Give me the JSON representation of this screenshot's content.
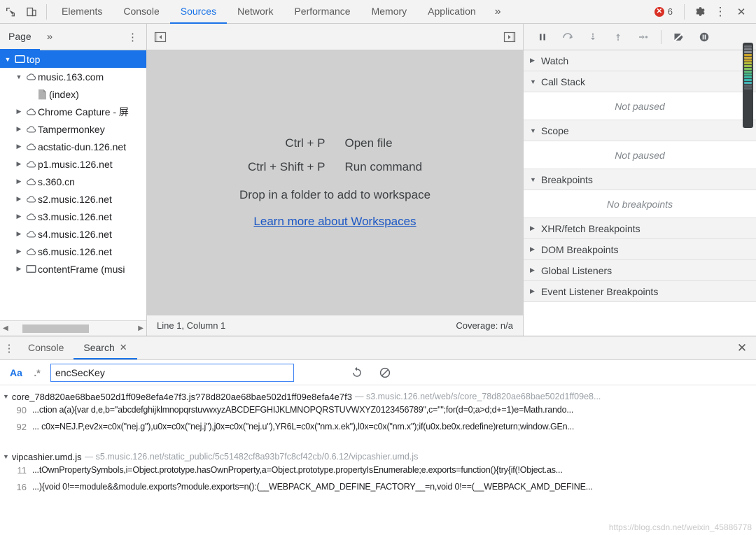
{
  "topbar": {
    "icons": [
      "inspect-icon",
      "device-toolbar-icon"
    ],
    "tabs": [
      {
        "label": "Elements",
        "active": false
      },
      {
        "label": "Console",
        "active": false
      },
      {
        "label": "Sources",
        "active": true
      },
      {
        "label": "Network",
        "active": false
      },
      {
        "label": "Performance",
        "active": false
      },
      {
        "label": "Memory",
        "active": false
      },
      {
        "label": "Application",
        "active": false
      }
    ],
    "more_label": "»",
    "error_count": "6",
    "settings_label": "⚙",
    "menu_label": "⋮",
    "close_label": "✕",
    "accent_color": "#1a73e8",
    "error_color": "#d93025"
  },
  "navigator": {
    "tab_label": "Page",
    "more_label": "»",
    "menu_label": "⋮",
    "tree": [
      {
        "label": "top",
        "icon": "frame-icon",
        "depth": 0,
        "arrow": "▼",
        "selected": true
      },
      {
        "label": "music.163.com",
        "icon": "cloud-icon",
        "depth": 1,
        "arrow": "▼",
        "selected": false
      },
      {
        "label": "(index)",
        "icon": "document-icon",
        "depth": 2,
        "arrow": "",
        "selected": false
      },
      {
        "label": "Chrome Capture - 屏",
        "icon": "cloud-icon",
        "depth": 1,
        "arrow": "▶",
        "selected": false
      },
      {
        "label": "Tampermonkey",
        "icon": "cloud-icon",
        "depth": 1,
        "arrow": "▶",
        "selected": false
      },
      {
        "label": "acstatic-dun.126.net",
        "icon": "cloud-icon",
        "depth": 1,
        "arrow": "▶",
        "selected": false
      },
      {
        "label": "p1.music.126.net",
        "icon": "cloud-icon",
        "depth": 1,
        "arrow": "▶",
        "selected": false
      },
      {
        "label": "s.360.cn",
        "icon": "cloud-icon",
        "depth": 1,
        "arrow": "▶",
        "selected": false
      },
      {
        "label": "s2.music.126.net",
        "icon": "cloud-icon",
        "depth": 1,
        "arrow": "▶",
        "selected": false
      },
      {
        "label": "s3.music.126.net",
        "icon": "cloud-icon",
        "depth": 1,
        "arrow": "▶",
        "selected": false
      },
      {
        "label": "s4.music.126.net",
        "icon": "cloud-icon",
        "depth": 1,
        "arrow": "▶",
        "selected": false
      },
      {
        "label": "s6.music.126.net",
        "icon": "cloud-icon",
        "depth": 1,
        "arrow": "▶",
        "selected": false
      },
      {
        "label": "contentFrame (musi",
        "icon": "frame-icon",
        "depth": 1,
        "arrow": "▶",
        "selected": false
      }
    ],
    "scroll_left": "◀",
    "scroll_right": "▶"
  },
  "editor": {
    "collapse_left_icon": "panel-collapse-left-icon",
    "collapse_right_icon": "panel-collapse-right-icon",
    "shortcuts": [
      {
        "key": "Ctrl + P",
        "desc": "Open file"
      },
      {
        "key": "Ctrl + Shift + P",
        "desc": "Run command"
      }
    ],
    "drop_hint": "Drop in a folder to add to workspace",
    "learn_link": "Learn more about Workspaces",
    "status_position": "Line 1, Column 1",
    "status_coverage": "Coverage: n/a"
  },
  "debugger": {
    "toolbar_buttons": [
      {
        "name": "resume-button",
        "glyph": "❙❙"
      },
      {
        "name": "step-over-button",
        "glyph": "↷"
      },
      {
        "name": "step-into-button",
        "glyph": "↓"
      },
      {
        "name": "step-out-button",
        "glyph": "↑"
      },
      {
        "name": "step-button",
        "glyph": "→"
      },
      {
        "name": "deactivate-breakpoints-button",
        "glyph": "⊘"
      },
      {
        "name": "pause-on-exceptions-button",
        "glyph": "⏸"
      }
    ],
    "sections": [
      {
        "title": "Watch",
        "arrow": "▶",
        "body": null
      },
      {
        "title": "Call Stack",
        "arrow": "▼",
        "body": "Not paused"
      },
      {
        "title": "Scope",
        "arrow": "▼",
        "body": "Not paused"
      },
      {
        "title": "Breakpoints",
        "arrow": "▼",
        "body": "No breakpoints"
      },
      {
        "title": "XHR/fetch Breakpoints",
        "arrow": "▶",
        "body": null
      },
      {
        "title": "DOM Breakpoints",
        "arrow": "▶",
        "body": null
      },
      {
        "title": "Global Listeners",
        "arrow": "▶",
        "body": null
      },
      {
        "title": "Event Listener Breakpoints",
        "arrow": "▶",
        "body": null
      }
    ],
    "minimap_colors": [
      "#6b6f73",
      "#7a7e82",
      "#8a8e92",
      "#c9a227",
      "#d4b23a",
      "#cfae2e",
      "#b7bf3a",
      "#9dc04a",
      "#7fc05e",
      "#5cbd77",
      "#44bb8c",
      "#3bb8a0",
      "#38b5ad",
      "#45b2b6",
      "#5c6368",
      "#5c6368"
    ]
  },
  "drawer": {
    "menu_label": "⋮",
    "tabs": [
      {
        "label": "Console",
        "active": false,
        "closable": false
      },
      {
        "label": "Search",
        "active": true,
        "closable": true,
        "close_glyph": "✕"
      }
    ],
    "close_label": "✕",
    "search": {
      "match_case_label": "Aa",
      "regex_label": ".*",
      "query": "encSecKey",
      "placeholder": "",
      "refresh_icon": "refresh-icon",
      "clear_icon": "clear-icon"
    },
    "results": [
      {
        "arrow": "▼",
        "file": "core_78d820ae68bae502d1ff09e8efa4e7f3.js?78d820ae68bae502d1ff09e8efa4e7f3",
        "url": "— s3.music.126.net/web/s/core_78d820ae68bae502d1ff09e8...",
        "lines": [
          {
            "num": "90",
            "code": "...ction a(a){var d,e,b=\"abcdefghijklmnopqrstuvwxyzABCDEFGHIJKLMNOPQRSTUVWXYZ0123456789\",c=\"\";for(d=0;a>d;d+=1)e=Math.rando..."
          },
          {
            "num": "92",
            "code": "... c0x=NEJ.P,ev2x=c0x(\"nej.g\"),u0x=c0x(\"nej.j\"),j0x=c0x(\"nej.u\"),YR6L=c0x(\"nm.x.ek\"),l0x=c0x(\"nm.x\");if(u0x.be0x.redefine)return;window.GEn..."
          }
        ]
      },
      {
        "arrow": "▼",
        "file": "vipcashier.umd.js",
        "url": "— s5.music.126.net/static_public/5c51482cf8a93b7fc8cf42cb/0.6.12/vipcashier.umd.js",
        "lines": [
          {
            "num": "11",
            "code": "...tOwnPropertySymbols,i=Object.prototype.hasOwnProperty,a=Object.prototype.propertyIsEnumerable;e.exports=function(){try{if(!Object.as..."
          },
          {
            "num": "16",
            "code": "...){void 0!==module&&module.exports?module.exports=n():(__WEBPACK_AMD_DEFINE_FACTORY__=n,void 0!==(__WEBPACK_AMD_DEFINE..."
          }
        ]
      }
    ],
    "watermark": "https://blog.csdn.net/weixin_45886778"
  }
}
